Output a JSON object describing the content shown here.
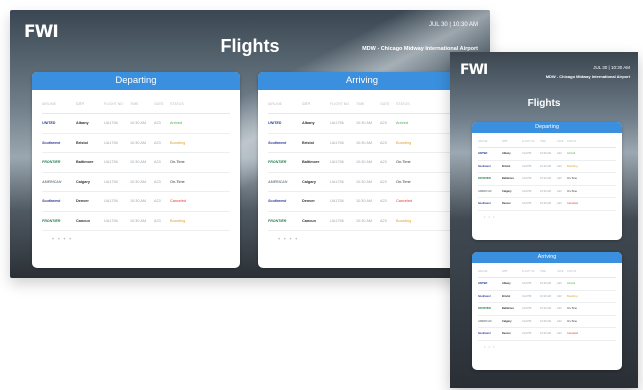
{
  "landscape": {
    "logo": "FWI",
    "title": "Flights",
    "datetime": "JUL 30 | 10:30 AM",
    "airport": "MDW - Chicago Midway International Airport",
    "departing": {
      "title": "Departing",
      "headers": [
        "Airline",
        "City",
        "Flight No",
        "Time",
        "Gate",
        "Status"
      ],
      "rows": [
        {
          "airline": "UNITED",
          "city": "Albany",
          "flight": "UA1756",
          "time": "10:30 AM",
          "gate": "A23",
          "status": "Arrived",
          "status_color": "#4caf50"
        },
        {
          "airline": "Southwest",
          "city": "Bristol",
          "flight": "UA1756",
          "time": "10:30 AM",
          "gate": "A23",
          "status": "Boarding",
          "status_color": "#e0a12c"
        },
        {
          "airline": "FRONTIER",
          "city": "Baltimore",
          "flight": "UA1756",
          "time": "10:30 AM",
          "gate": "A23",
          "status": "On-Time",
          "status_color": "#333333"
        },
        {
          "airline": "AMERICAN",
          "city": "Calgary",
          "flight": "UA1756",
          "time": "10:30 AM",
          "gate": "A23",
          "status": "On-Time",
          "status_color": "#333333"
        },
        {
          "airline": "Southwest",
          "city": "Denver",
          "flight": "UA1756",
          "time": "10:30 AM",
          "gate": "A23",
          "status": "Canceled",
          "status_color": "#e53935"
        },
        {
          "airline": "FRONTIER",
          "city": "Cancun",
          "flight": "UA1756",
          "time": "10:30 AM",
          "gate": "A23",
          "status": "Boarding",
          "status_color": "#e0a12c"
        }
      ],
      "pager": "• • • •"
    },
    "arriving": {
      "title": "Arriving",
      "headers": [
        "Airline",
        "City",
        "Flight No",
        "Time",
        "Gate",
        "Status"
      ],
      "rows": [
        {
          "airline": "UNITED",
          "city": "Albany",
          "flight": "UA1756",
          "time": "10:30 AM",
          "gate": "A23",
          "status": "Arrived",
          "status_color": "#4caf50"
        },
        {
          "airline": "Southwest",
          "city": "Bristol",
          "flight": "UA1756",
          "time": "10:30 AM",
          "gate": "A23",
          "status": "Boarding",
          "status_color": "#e0a12c"
        },
        {
          "airline": "FRONTIER",
          "city": "Baltimore",
          "flight": "UA1756",
          "time": "10:30 AM",
          "gate": "A23",
          "status": "On-Time",
          "status_color": "#333333"
        },
        {
          "airline": "AMERICAN",
          "city": "Calgary",
          "flight": "UA1756",
          "time": "10:30 AM",
          "gate": "A23",
          "status": "On-Time",
          "status_color": "#333333"
        },
        {
          "airline": "Southwest",
          "city": "Denver",
          "flight": "UA1756",
          "time": "10:30 AM",
          "gate": "A23",
          "status": "Canceled",
          "status_color": "#e53935"
        },
        {
          "airline": "FRONTIER",
          "city": "Cancun",
          "flight": "UA1756",
          "time": "10:30 AM",
          "gate": "A23",
          "status": "Boarding",
          "status_color": "#e0a12c"
        }
      ],
      "pager": "• • • •"
    }
  },
  "portrait": {
    "logo": "FWI",
    "title": "Flights",
    "datetime": "JUL 30 | 10:30 AM",
    "airport": "MDW - Chicago Midway International Airport",
    "departing": {
      "title": "Departing",
      "headers": [
        "Airline",
        "City",
        "Flight No",
        "Time",
        "Gate",
        "Status"
      ],
      "rows": [
        {
          "airline": "UNITED",
          "city": "Albany",
          "flight": "UA1756",
          "time": "10:30 AM",
          "gate": "A23",
          "status": "Arrived",
          "status_color": "#4caf50"
        },
        {
          "airline": "Southwest",
          "city": "Bristol",
          "flight": "UA1756",
          "time": "10:30 AM",
          "gate": "A23",
          "status": "Boarding",
          "status_color": "#e0a12c"
        },
        {
          "airline": "FRONTIER",
          "city": "Baltimore",
          "flight": "UA1756",
          "time": "10:30 AM",
          "gate": "A23",
          "status": "On-Time",
          "status_color": "#333333"
        },
        {
          "airline": "AMERICAN",
          "city": "Calgary",
          "flight": "UA1756",
          "time": "10:30 AM",
          "gate": "A23",
          "status": "On-Time",
          "status_color": "#333333"
        },
        {
          "airline": "Southwest",
          "city": "Denver",
          "flight": "UA1756",
          "time": "10:30 AM",
          "gate": "A23",
          "status": "Canceled",
          "status_color": "#e53935"
        }
      ],
      "pager": "• • •"
    },
    "arriving": {
      "title": "Arriving",
      "headers": [
        "Airline",
        "City",
        "Flight No",
        "Time",
        "Gate",
        "Status"
      ],
      "rows": [
        {
          "airline": "UNITED",
          "city": "Albany",
          "flight": "UA1756",
          "time": "10:30 AM",
          "gate": "A23",
          "status": "Arrived",
          "status_color": "#4caf50"
        },
        {
          "airline": "Southwest",
          "city": "Bristol",
          "flight": "UA1756",
          "time": "10:30 AM",
          "gate": "A23",
          "status": "Boarding",
          "status_color": "#e0a12c"
        },
        {
          "airline": "FRONTIER",
          "city": "Baltimore",
          "flight": "UA1756",
          "time": "10:30 AM",
          "gate": "A23",
          "status": "On-Time",
          "status_color": "#333333"
        },
        {
          "airline": "AMERICAN",
          "city": "Calgary",
          "flight": "UA1756",
          "time": "10:30 AM",
          "gate": "A23",
          "status": "On-Time",
          "status_color": "#333333"
        },
        {
          "airline": "Southwest",
          "city": "Denver",
          "flight": "UA1756",
          "time": "10:30 AM",
          "gate": "A23",
          "status": "Canceled",
          "status_color": "#e53935"
        }
      ],
      "pager": "• • •"
    }
  },
  "colors": {
    "panel_header": "#3a8fde",
    "united": "#1a3c8f",
    "southwest": "#2f3e9e",
    "frontier": "#1d7a4a",
    "american": "#7d8793"
  }
}
